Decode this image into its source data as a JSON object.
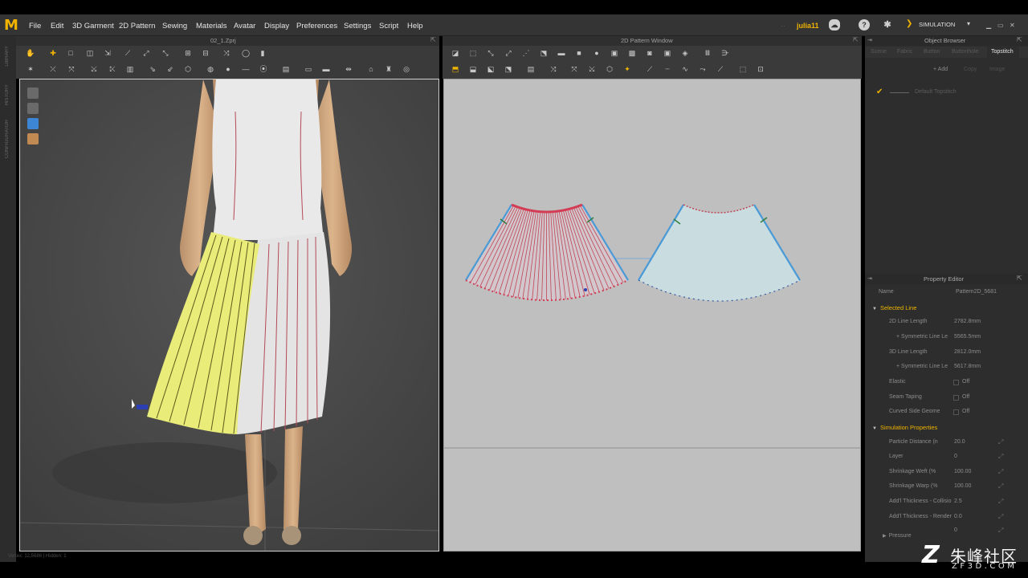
{
  "app": {
    "logo": "M",
    "menus": [
      "File",
      "Edit",
      "3D Garment",
      "2D Pattern",
      "Sewing",
      "Materials",
      "Avatar",
      "Display",
      "Preferences",
      "Settings",
      "Script",
      "Help"
    ],
    "user": "julia11",
    "mode": "SIMULATION",
    "accent_color": "#f0b400"
  },
  "left_sidebar": {
    "tabs": [
      "LIBRARY",
      "HISTORY",
      "CONFIGURATOR"
    ]
  },
  "panel_3d": {
    "title": "02_1.Zprj",
    "status": "Vertex: 12,5686 | Hidden: 1"
  },
  "panel_2d": {
    "title": "2D Pattern Window"
  },
  "object_browser": {
    "title": "Object Browser",
    "tabs": [
      "Scene",
      "Fabric",
      "Button",
      "Buttonhole",
      "Topstitch"
    ],
    "active_tab": "Topstitch",
    "buttons": {
      "add": "+ Add",
      "copy": "Copy",
      "image": "Image"
    },
    "items": [
      {
        "label": "Default Topstitch",
        "checked": true
      }
    ]
  },
  "property_editor": {
    "title": "Property Editor",
    "name_label": "Name",
    "name_value": "Pattern2D_5681",
    "selected_line": {
      "title": "Selected Line",
      "rows": [
        {
          "label": "2D Line Length",
          "value": "2782.8mm"
        },
        {
          "label": "+ Symmetric Line Le",
          "value": "5565.5mm"
        },
        {
          "label": "3D Line Length",
          "value": "2812.0mm"
        },
        {
          "label": "+ Symmetric Line Le",
          "value": "5617.8mm"
        },
        {
          "label": "Elastic",
          "value": "Off"
        },
        {
          "label": "Seam Taping",
          "value": "Off"
        },
        {
          "label": "Curved Side Geome",
          "value": "Off"
        }
      ]
    },
    "simulation_properties": {
      "title": "Simulation Properties",
      "rows": [
        {
          "label": "Particle Distance (n",
          "value": "20.0"
        },
        {
          "label": "Layer",
          "value": "0"
        },
        {
          "label": "Shrinkage Weft (%",
          "value": "100.00"
        },
        {
          "label": "Shrinkage Warp (%",
          "value": "100.00"
        },
        {
          "label": "Add'l Thickness - Collisio",
          "value": "2.5"
        },
        {
          "label": "Add'l Thickness - Render",
          "value": "0.0"
        }
      ],
      "pressure_label": "Pressure",
      "pressure_value": "0"
    }
  },
  "watermark": {
    "logo": "Z",
    "text": "朱峰社区",
    "url": "ZF3D.COM"
  }
}
